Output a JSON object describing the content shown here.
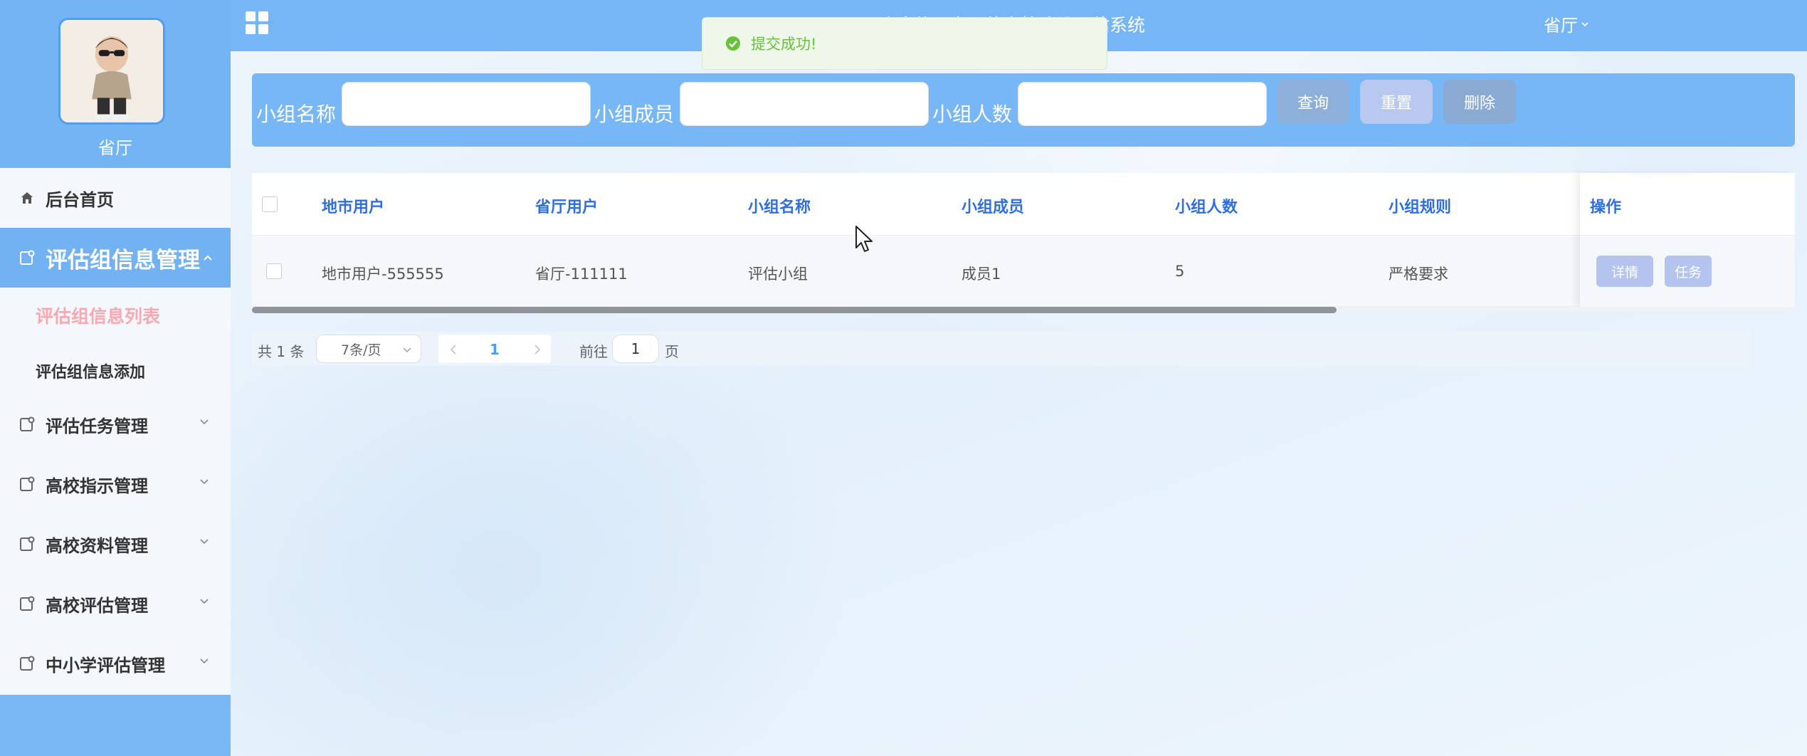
{
  "colors": {
    "sidebar_bg": "#7ab8f5",
    "header_bg": "#76b6f6",
    "active_menu_bg": "#72b2f2",
    "submenu_current": "#f7a8b0",
    "table_header_text": "#2d6fe0",
    "toast_success": "#67c23a",
    "link_blue": "#409eff"
  },
  "profile": {
    "name": "省厅",
    "avatar_icon": "child-avatar-photo"
  },
  "header": {
    "grid_icon": "grid-icon",
    "title": "欢迎使用省评估高校建设评估系统",
    "user": "省厅"
  },
  "toast": {
    "icon": "check-circle-icon",
    "message": "提交成功!"
  },
  "sidebar": {
    "items": [
      {
        "label": "后台首页",
        "icon": "home-icon"
      },
      {
        "label": "评估组信息管理",
        "icon": "clipboard-icon",
        "expanded": true,
        "children": [
          {
            "label": "评估组信息列表",
            "current": true
          },
          {
            "label": "评估组信息添加",
            "current": false
          }
        ]
      },
      {
        "label": "评估任务管理",
        "icon": "clipboard-icon"
      },
      {
        "label": "高校指示管理",
        "icon": "clipboard-icon"
      },
      {
        "label": "高校资料管理",
        "icon": "clipboard-icon"
      },
      {
        "label": "高校评估管理",
        "icon": "clipboard-icon"
      },
      {
        "label": "中小学评估管理",
        "icon": "clipboard-icon"
      }
    ]
  },
  "search": {
    "group_name_label": "小组名称",
    "group_name_value": "",
    "members_label": "小组成员",
    "members_value": "",
    "count_label": "小组人数",
    "count_value": "",
    "query_button": "查询",
    "reset_button": "重置",
    "delete_button": "删除"
  },
  "table": {
    "columns": [
      "地市用户",
      "省厅用户",
      "小组名称",
      "小组成员",
      "小组人数",
      "小组规则",
      "操作"
    ],
    "rows": [
      {
        "city_user": "地市用户-555555",
        "province_user": "省厅-111111",
        "group_name": "评估小组",
        "members": "成员1",
        "count": "5",
        "rules": "严格要求",
        "actions": [
          "详情",
          "任务"
        ]
      }
    ]
  },
  "pagination": {
    "total": "共 1 条",
    "page_size": "7条/页",
    "current_page": "1",
    "goto_label": "前往",
    "goto_value": "1",
    "page_suffix": "页"
  }
}
